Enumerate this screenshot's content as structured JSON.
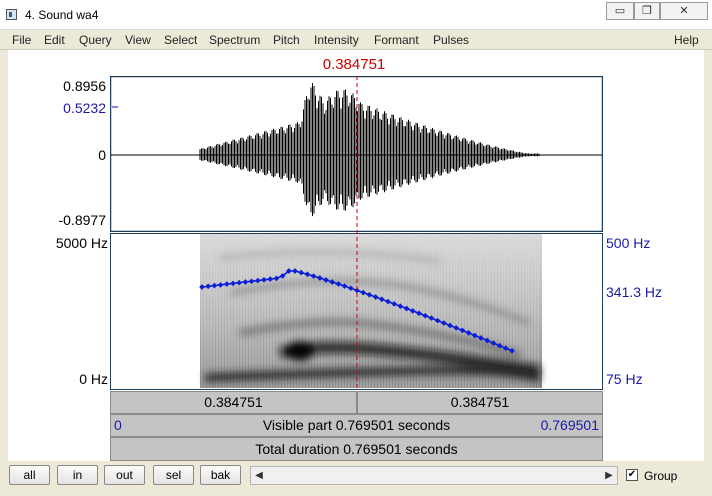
{
  "window": {
    "title": "4. Sound wa4",
    "minimize_glyph": "▭",
    "restore_glyph": "❐",
    "close_glyph": "✕"
  },
  "menu": [
    "File",
    "Edit",
    "Query",
    "View",
    "Select",
    "Spectrum",
    "Pitch",
    "Intensity",
    "Formant",
    "Pulses",
    "Help"
  ],
  "cursor": {
    "time_label": "0.384751",
    "position_fraction": 0.5,
    "color": "#cc0000"
  },
  "waveform": {
    "top_label": "0.8956",
    "cursor_value_label": "0.5232",
    "zero_label": "0",
    "bottom_label": "-0.8977"
  },
  "spectrogram": {
    "freq_top_label": "5000 Hz",
    "freq_bottom_label": "0 Hz",
    "pitch_top_label": "500 Hz",
    "pitch_cursor_label": "341.3 Hz",
    "pitch_bottom_label": "75 Hz",
    "pitch_color": "#0a1fd6"
  },
  "time_bars": {
    "left_segment": "0.384751",
    "right_segment": "0.384751",
    "visible_start": "0",
    "visible_label": "Visible part 0.769501 seconds",
    "visible_end": "0.769501",
    "total_label": "Total duration 0.769501 seconds"
  },
  "buttons": {
    "all": "all",
    "in": "in",
    "out": "out",
    "sel": "sel",
    "bak": "bak"
  },
  "scroll": {
    "left_arrow": "◀",
    "right_arrow": "▶"
  },
  "group": {
    "label": "Group",
    "checked": true,
    "check_glyph": "✔"
  }
}
